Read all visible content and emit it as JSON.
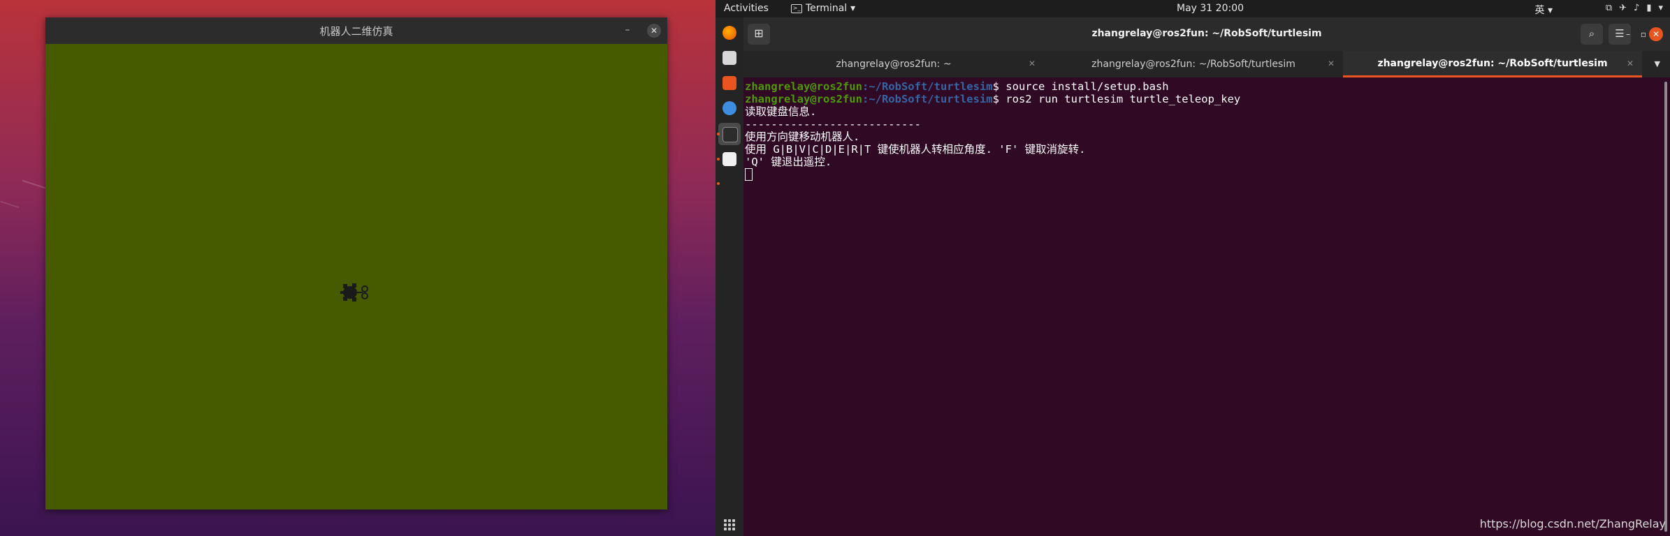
{
  "sim_window": {
    "title": "机器人二维仿真",
    "minimize_label": "–",
    "close_label": "✕",
    "background_color": "#465a00"
  },
  "topbar": {
    "activities": "Activities",
    "app_name": "Terminal",
    "app_dropdown": "▾",
    "clock": "May 31  20:00",
    "input_method": "英 ▾",
    "system_icons": [
      "network-icon",
      "airplane-icon",
      "volume-icon",
      "battery-icon",
      "power-menu-icon"
    ]
  },
  "dock": {
    "items": [
      "firefox-icon",
      "files-icon",
      "software-center-icon",
      "help-icon",
      "terminal-icon",
      "text-editor-icon"
    ]
  },
  "terminal": {
    "title": "zhangrelay@ros2fun: ~/RobSoft/turtlesim",
    "tabs": [
      {
        "label": "zhangrelay@ros2fun: ~",
        "active": false
      },
      {
        "label": "zhangrelay@ros2fun: ~/RobSoft/turtlesim",
        "active": false
      },
      {
        "label": "zhangrelay@ros2fun: ~/RobSoft/turtlesim",
        "active": true
      }
    ],
    "prompt_user": "zhangrelay@ros2fun",
    "prompt_path": ":~/RobSoft/turtlesim",
    "prompt_symbol": "$ ",
    "commands": [
      "source install/setup.bash",
      "ros2 run turtlesim turtle_teleop_key"
    ],
    "output": [
      "读取键盘信息.",
      "---------------------------",
      "使用方向键移动机器人.",
      "使用 G|B|V|C|D|E|R|T 键使机器人转相应角度. 'F' 键取消旋转.",
      "'Q' 键退出遥控."
    ]
  },
  "watermark": "https://blog.csdn.net/ZhangRelay",
  "colors": {
    "accent": "#e95420",
    "terminal_bg": "#300a24",
    "prompt_user": "#4e9a06",
    "prompt_path": "#3465a4"
  }
}
